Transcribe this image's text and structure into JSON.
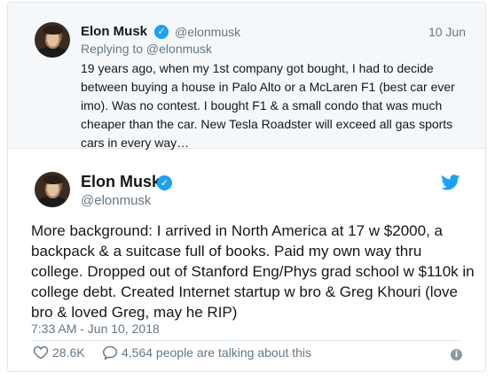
{
  "parent_tweet": {
    "name": "Elon Musk",
    "handle": "@elonmusk",
    "date": "10 Jun",
    "replying_to": "Replying to @elonmusk",
    "text": "19 years ago, when my 1st company got bought, I had to decide between buying a house in Palo Alto or a McLaren F1 (best car ever imo). Was no contest. I bought F1 & a small condo that was much cheaper than the car. New Tesla Roadster will exceed all gas sports cars in every way…"
  },
  "main_tweet": {
    "name": "Elon Musk",
    "handle": "@elonmusk",
    "text": "More background: I arrived in North America at 17 w $2000, a backpack & a suitcase full of books. Paid my own way thru college. Dropped out of Stanford Eng/Phys grad school w $110k in college debt. Created Internet startup w bro & Greg Khouri (love bro & loved Greg, may he RIP)",
    "timestamp": "7:33 AM - Jun 10, 2018",
    "likes": "28.6K",
    "talking": "4,564 people are talking about this"
  },
  "icons": {
    "verified": "verified-badge-icon",
    "bird": "twitter-bird-icon",
    "heart": "heart-icon",
    "comment": "comment-icon",
    "info": "info-icon"
  },
  "colors": {
    "accent": "#1da1f2",
    "muted": "#657786",
    "text": "#14171a",
    "parent_bg": "#f5f8fa"
  }
}
